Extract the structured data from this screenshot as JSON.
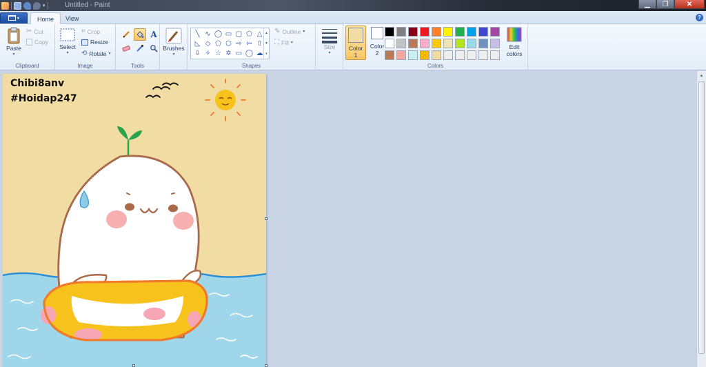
{
  "window": {
    "title": "Untitled - Paint"
  },
  "tabs": [
    {
      "label": "Home",
      "active": true
    },
    {
      "label": "View",
      "active": false
    }
  ],
  "clipboard": {
    "paste_label": "Paste",
    "cut_label": "Cut",
    "copy_label": "Copy",
    "group_label": "Clipboard"
  },
  "image": {
    "select_label": "Select",
    "crop_label": "Crop",
    "resize_label": "Resize",
    "rotate_label": "Rotate",
    "group_label": "Image"
  },
  "tools": {
    "group_label": "Tools",
    "items": [
      "pencil-icon",
      "fill-icon",
      "text-icon",
      "eraser-icon",
      "color-picker-icon",
      "magnifier-icon"
    ],
    "selected": "fill-icon"
  },
  "brushes": {
    "label": "Brushes"
  },
  "shapes": {
    "group_label": "Shapes",
    "outline_label": "Outline",
    "fill_label": "Fill"
  },
  "size": {
    "label": "Size"
  },
  "colors": {
    "group_label": "Colors",
    "color1_label": "Color\n1",
    "color2_label": "Color\n2",
    "color1": "#f1dca4",
    "color2": "#ffffff",
    "edit_label": "Edit\ncolors",
    "palette": [
      "#000000",
      "#7f7f7f",
      "#880015",
      "#ed1c24",
      "#ff7f27",
      "#fff200",
      "#22b14c",
      "#00a2e8",
      "#3f48cc",
      "#a349a4",
      "#ffffff",
      "#c3c3c3",
      "#b97a57",
      "#ffaec9",
      "#ffc90e",
      "#efe4b0",
      "#b5e61d",
      "#99d9ea",
      "#7092be",
      "#c8bfe7",
      "#b97a57",
      "#f4a6a0",
      "#c8f0f5",
      "#f5b800",
      "#f1dca4",
      "#eeeeee",
      "#eeeeee",
      "#eeeeee",
      "#eeeeee",
      "#eeeeee"
    ]
  },
  "canvas": {
    "line1": "Chibi8anv",
    "line2": "#Hoidap247"
  }
}
